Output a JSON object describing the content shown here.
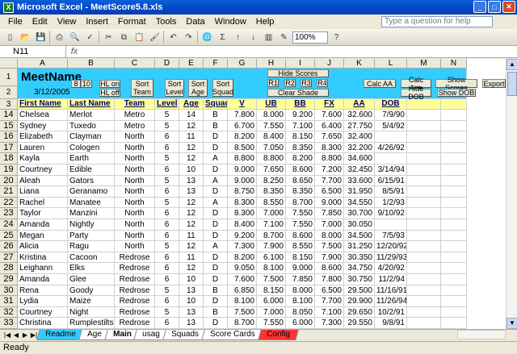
{
  "window": {
    "title": "Microsoft Excel - MeetScore5.8.xls"
  },
  "menu": [
    "File",
    "Edit",
    "View",
    "Insert",
    "Format",
    "Tools",
    "Data",
    "Window",
    "Help"
  ],
  "help_placeholder": "Type a question for help",
  "zoom": "100%",
  "namebox": "N11",
  "fx": "fx",
  "columns": [
    "A",
    "B",
    "C",
    "D",
    "E",
    "F",
    "G",
    "H",
    "I",
    "J",
    "K",
    "L",
    "M",
    "N"
  ],
  "header": {
    "title": "MeetName",
    "date": "3/12/2005",
    "btn_8": "8",
    "btn_10": "10",
    "btn_hl_on": "HL on",
    "btn_hl_off": "HL off",
    "btn_sort_team": "Sort Team",
    "btn_sort_level": "Sort Level",
    "btn_sort_age": "Sort Age",
    "btn_sort_squad": "Sort Squad",
    "btn_hide_scores": "Hide Scores",
    "btn_r1": "R1",
    "btn_r2": "R2",
    "btn_r3": "R3",
    "btn_r4": "R4",
    "btn_clear_shade": "Clear Shade",
    "btn_calc_aa": "Calc AA",
    "btn_calc_age": "Calc Age",
    "btn_hide_dob": "Hide DOB",
    "btn_show_scores": "Show Scores",
    "btn_show_dob": "Show DOB",
    "btn_export": "Export"
  },
  "col_headers": [
    "First Name",
    "Last Name",
    "Team",
    "Level",
    "Age",
    "Squad",
    "V",
    "UB",
    "BB",
    "FX",
    "AA",
    "DOB"
  ],
  "rows": [
    {
      "n": "14",
      "c": [
        "Chelsea",
        "Merlot",
        "Metro",
        "5",
        "14",
        "B",
        "7.800",
        "8.000",
        "9.200",
        "7.600",
        "32.600",
        "7/9/90"
      ]
    },
    {
      "n": "15",
      "c": [
        "Sydney",
        "Tuxedo",
        "Metro",
        "5",
        "12",
        "B",
        "6.700",
        "7.550",
        "7.100",
        "6.400",
        "27.750",
        "5/4/92"
      ]
    },
    {
      "n": "16",
      "c": [
        "Elizabeth",
        "Clayman",
        "North",
        "6",
        "11",
        "D",
        "8.200",
        "8.400",
        "8.150",
        "7.650",
        "32.400",
        ""
      ]
    },
    {
      "n": "17",
      "c": [
        "Lauren",
        "Cologen",
        "North",
        "6",
        "12",
        "D",
        "8.500",
        "7.050",
        "8.350",
        "8.300",
        "32.200",
        "4/26/92"
      ]
    },
    {
      "n": "18",
      "c": [
        "Kayla",
        "Earth",
        "North",
        "5",
        "12",
        "A",
        "8.800",
        "8.800",
        "8.200",
        "8.800",
        "34.600",
        ""
      ]
    },
    {
      "n": "19",
      "c": [
        "Courtney",
        "Edible",
        "North",
        "6",
        "10",
        "D",
        "9.000",
        "7.650",
        "8.600",
        "7.200",
        "32.450",
        "3/14/94"
      ]
    },
    {
      "n": "20",
      "c": [
        "Aleah",
        "Gators",
        "North",
        "5",
        "13",
        "A",
        "9.000",
        "8.250",
        "8.650",
        "7.700",
        "33.600",
        "6/15/91"
      ]
    },
    {
      "n": "21",
      "c": [
        "Liana",
        "Geranamo",
        "North",
        "6",
        "13",
        "D",
        "8.750",
        "8.350",
        "8.350",
        "6.500",
        "31.950",
        "8/5/91"
      ]
    },
    {
      "n": "22",
      "c": [
        "Rachel",
        "Manatee",
        "North",
        "5",
        "12",
        "A",
        "8.300",
        "8.550",
        "8.700",
        "9.000",
        "34.550",
        "1/2/93"
      ]
    },
    {
      "n": "23",
      "c": [
        "Taylor",
        "Manzini",
        "North",
        "6",
        "12",
        "D",
        "8.300",
        "7.000",
        "7.550",
        "7.850",
        "30.700",
        "9/10/92"
      ]
    },
    {
      "n": "24",
      "c": [
        "Amanda",
        "Nightly",
        "North",
        "6",
        "12",
        "D",
        "8.400",
        "7.100",
        "7.550",
        "7.000",
        "30.050",
        ""
      ]
    },
    {
      "n": "25",
      "c": [
        "Megan",
        "Party",
        "North",
        "6",
        "11",
        "D",
        "9.200",
        "8.700",
        "8.600",
        "8.000",
        "34.500",
        "7/5/93"
      ]
    },
    {
      "n": "26",
      "c": [
        "Alicia",
        "Ragu",
        "North",
        "5",
        "12",
        "A",
        "7.300",
        "7.900",
        "8.550",
        "7.500",
        "31.250",
        "12/20/92"
      ]
    },
    {
      "n": "27",
      "c": [
        "Kristina",
        "Cacoon",
        "Redrose",
        "6",
        "11",
        "D",
        "8.200",
        "6.100",
        "8.150",
        "7.900",
        "30.350",
        "11/29/93"
      ]
    },
    {
      "n": "28",
      "c": [
        "Leighann",
        "Elks",
        "Redrose",
        "6",
        "12",
        "D",
        "9.050",
        "8.100",
        "9.000",
        "8.600",
        "34.750",
        "4/20/92"
      ]
    },
    {
      "n": "29",
      "c": [
        "Amanda",
        "Glee",
        "Redrose",
        "6",
        "10",
        "D",
        "7.600",
        "7.500",
        "7.850",
        "7.800",
        "30.750",
        "11/2/94"
      ]
    },
    {
      "n": "30",
      "c": [
        "Rena",
        "Goody",
        "Redrose",
        "5",
        "13",
        "B",
        "6.850",
        "8.150",
        "8.000",
        "6.500",
        "29.500",
        "11/16/91"
      ]
    },
    {
      "n": "31",
      "c": [
        "Lydia",
        "Maize",
        "Redrose",
        "6",
        "10",
        "D",
        "8.100",
        "6.000",
        "8.100",
        "7.700",
        "29.900",
        "11/26/94"
      ]
    },
    {
      "n": "32",
      "c": [
        "Courtney",
        "Night",
        "Redrose",
        "5",
        "13",
        "B",
        "7.500",
        "7.000",
        "8.050",
        "7.100",
        "29.650",
        "10/2/91"
      ]
    },
    {
      "n": "33",
      "c": [
        "Christina",
        "Rumplestiltskin",
        "Redrose",
        "6",
        "13",
        "D",
        "8.700",
        "7.550",
        "6.000",
        "7.300",
        "29.550",
        "9/8/91"
      ]
    },
    {
      "n": "34",
      "c": [
        "Jenn",
        "Vogue",
        "Redrose",
        "6",
        "14",
        "D",
        "8.000",
        "6.700",
        "8.000",
        "7.600",
        "30.300",
        "11/23/90"
      ]
    },
    {
      "n": "35",
      "c": [
        "Megan",
        "Winds",
        "Redrose",
        "6",
        "12",
        "D",
        "7.800",
        "7.600",
        "7.200",
        "7.800",
        "30.400",
        "3/31/92"
      ]
    }
  ],
  "sheets": [
    {
      "name": "Readme",
      "color": "#33ccff"
    },
    {
      "name": "Age",
      "color": "#ffffff"
    },
    {
      "name": "Main",
      "color": "#ffffff"
    },
    {
      "name": "usag",
      "color": "#ffffff"
    },
    {
      "name": "Squads",
      "color": "#ffffff"
    },
    {
      "name": "Score Cards",
      "color": "#ffffff"
    },
    {
      "name": "Config",
      "color": "#ff3333"
    }
  ],
  "status": "Ready"
}
